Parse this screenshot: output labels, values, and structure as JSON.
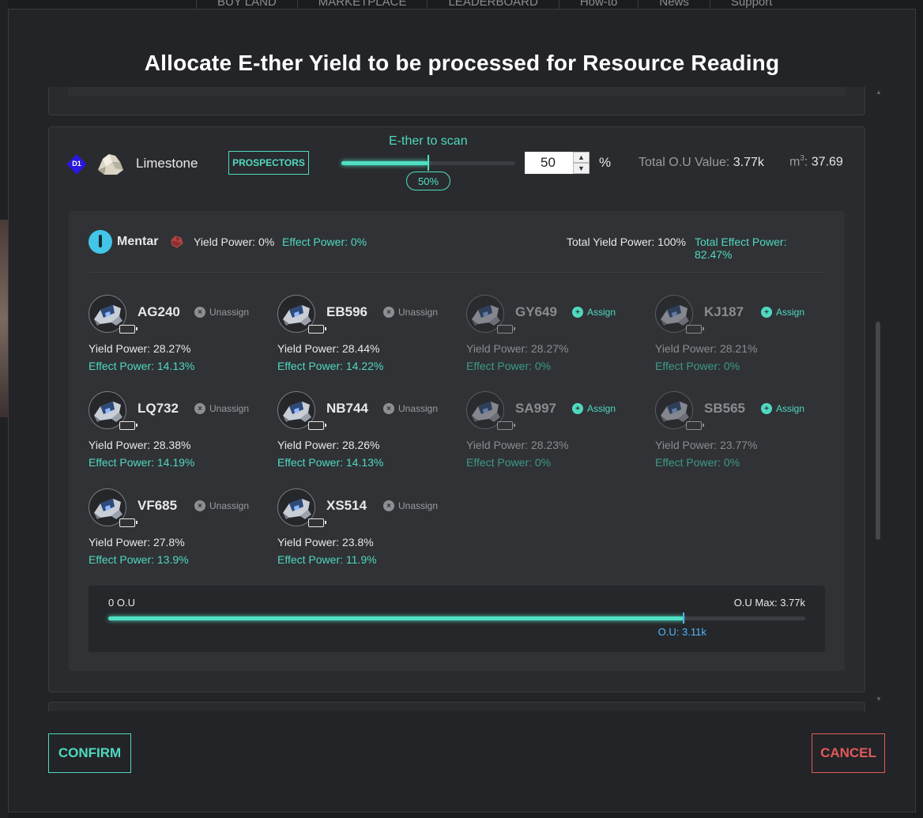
{
  "background": {
    "nav_items": [
      "BUY LAND",
      "MARKETPLACE",
      "LEADERBOARD",
      "How-to",
      "News",
      "Support"
    ]
  },
  "modal": {
    "title": "Allocate E-ther Yield to be processed for Resource Reading",
    "confirm_label": "CONFIRM",
    "cancel_label": "CANCEL"
  },
  "resource": {
    "tier": "D1",
    "icon": "limestone-rock-icon",
    "name": "Limestone",
    "prospectors_label": "PROSPECTORS",
    "scan_label": "E-ther to scan",
    "scan_percent_value": 50,
    "scan_percent_label": "50%",
    "input_value": "50",
    "percent_sign": "%",
    "total_ou_label": "Total O.U Value:",
    "total_ou_value": "3.77k",
    "volume_unit": "m",
    "volume_sup": "3",
    "volume_value": "37.69"
  },
  "mentar": {
    "icon": "mentar-icon",
    "name": "Mentar",
    "gem_icon": "ruby-gem-icon",
    "yield_power": "Yield Power: 0%",
    "effect_power": "Effect Power: 0%",
    "total_yield_power": "Total Yield Power: 100%",
    "total_effect_power": "Total Effect Power: 82.47%"
  },
  "units": [
    {
      "code": "AG240",
      "action": "Unassign",
      "assigned": true,
      "yield": "Yield Power: 28.27%",
      "effect": "Effect Power: 14.13%"
    },
    {
      "code": "EB596",
      "action": "Unassign",
      "assigned": true,
      "yield": "Yield Power: 28.44%",
      "effect": "Effect Power: 14.22%"
    },
    {
      "code": "GY649",
      "action": "Assign",
      "assigned": false,
      "yield": "Yield Power: 28.27%",
      "effect": "Effect Power: 0%"
    },
    {
      "code": "KJ187",
      "action": "Assign",
      "assigned": false,
      "yield": "Yield Power: 28.21%",
      "effect": "Effect Power: 0%"
    },
    {
      "code": "LQ732",
      "action": "Unassign",
      "assigned": true,
      "yield": "Yield Power: 28.38%",
      "effect": "Effect Power: 14.19%"
    },
    {
      "code": "NB744",
      "action": "Unassign",
      "assigned": true,
      "yield": "Yield Power: 28.26%",
      "effect": "Effect Power: 14.13%"
    },
    {
      "code": "SA997",
      "action": "Assign",
      "assigned": false,
      "yield": "Yield Power: 28.23%",
      "effect": "Effect Power: 0%"
    },
    {
      "code": "SB565",
      "action": "Assign",
      "assigned": false,
      "yield": "Yield Power: 23.77%",
      "effect": "Effect Power: 0%"
    },
    {
      "code": "VF685",
      "action": "Unassign",
      "assigned": true,
      "yield": "Yield Power: 27.8%",
      "effect": "Effect Power: 13.9%"
    },
    {
      "code": "XS514",
      "action": "Unassign",
      "assigned": true,
      "yield": "Yield Power: 23.8%",
      "effect": "Effect Power: 11.9%"
    }
  ],
  "ou_bar": {
    "min_label": "0 O.U",
    "max_label": "O.U Max: 3.77k",
    "current_label": "O.U: 3.11k",
    "fraction": 0.825
  },
  "colors": {
    "accent": "#4fd9bf",
    "cancel": "#e05a5a",
    "tier_badge": "#2a17e0",
    "ou_current": "#4fb8ff"
  }
}
